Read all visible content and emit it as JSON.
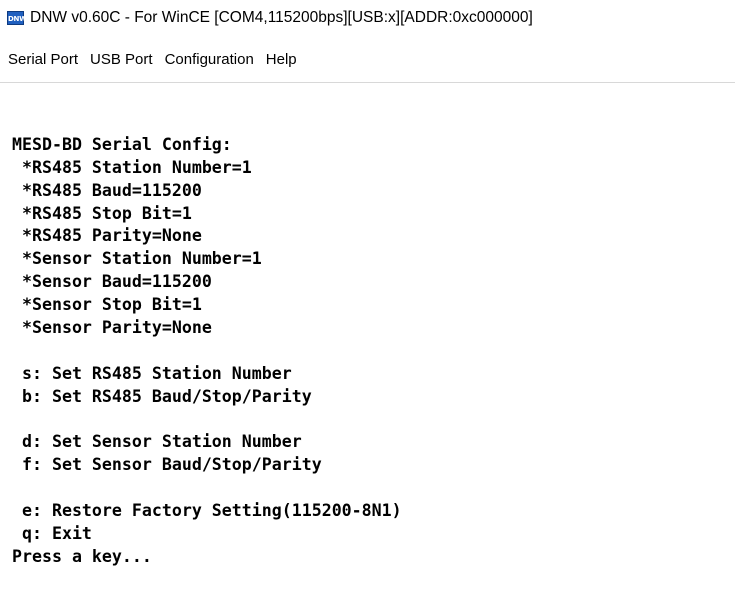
{
  "window": {
    "icon": "dnw-app-icon",
    "icon_label": "DNW",
    "title": "DNW v0.60C - For WinCE   [COM4,115200bps][USB:x][ADDR:0xc000000]"
  },
  "menu": {
    "items": [
      "Serial Port",
      "USB Port",
      "Configuration",
      "Help"
    ]
  },
  "terminal": {
    "lines": [
      "",
      "MESD-BD Serial Config:",
      " *RS485 Station Number=1",
      " *RS485 Baud=115200",
      " *RS485 Stop Bit=1",
      " *RS485 Parity=None",
      " *Sensor Station Number=1",
      " *Sensor Baud=115200",
      " *Sensor Stop Bit=1",
      " *Sensor Parity=None",
      "",
      " s: Set RS485 Station Number",
      " b: Set RS485 Baud/Stop/Parity",
      "",
      " d: Set Sensor Station Number",
      " f: Set Sensor Baud/Stop/Parity",
      "",
      " e: Restore Factory Setting(115200-8N1)",
      " q: Exit",
      "Press a key..."
    ]
  }
}
